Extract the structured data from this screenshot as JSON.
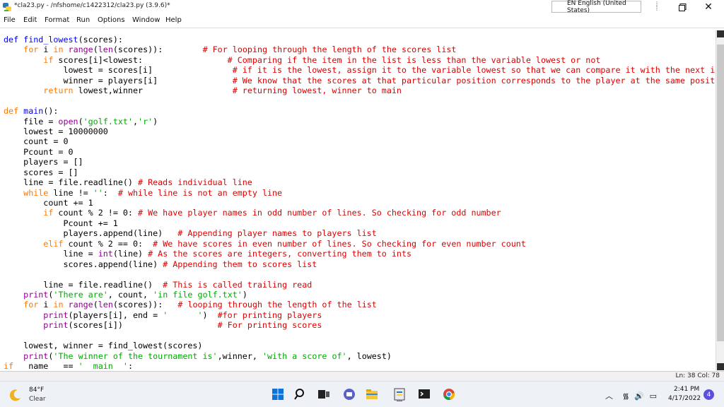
{
  "window": {
    "title": "*cla23.py - /nfshome/c1422312/cla23.py (3.9.6)*",
    "language": "EN English (United States)"
  },
  "menu": {
    "file": "File",
    "edit": "Edit",
    "format": "Format",
    "run": "Run",
    "options": "Options",
    "window": "Window",
    "help": "Help"
  },
  "code_lines": [
    [
      [
        "def",
        "def"
      ],
      [
        "t",
        " "
      ],
      [
        "def",
        "find_lowest"
      ],
      [
        "t",
        "(scores):"
      ]
    ],
    [
      [
        "t",
        "    "
      ],
      [
        "kw",
        "for"
      ],
      [
        "t",
        " i "
      ],
      [
        "kw",
        "in"
      ],
      [
        "t",
        " "
      ],
      [
        "bi",
        "range"
      ],
      [
        "t",
        "("
      ],
      [
        "bi",
        "len"
      ],
      [
        "t",
        "(scores)):        "
      ],
      [
        "cm",
        "# For looping through the length of the scores list"
      ]
    ],
    [
      [
        "t",
        "        "
      ],
      [
        "kw",
        "if"
      ],
      [
        "t",
        " scores[i]<lowest:                 "
      ],
      [
        "cm",
        "# Comparing if the item in the list is less than the variable lowest or not"
      ]
    ],
    [
      [
        "t",
        "            lowest = scores[i]                "
      ],
      [
        "cm",
        "# if it is the lowest, assign it to the variable lowest so that we can compare it with the next iter"
      ]
    ],
    [
      [
        "t",
        "            winner = players[i]               "
      ],
      [
        "cm",
        "# We know that the scores at that particular position corresponds to the player at the same position"
      ]
    ],
    [
      [
        "t",
        "        "
      ],
      [
        "kw",
        "return"
      ],
      [
        "t",
        " lowest,winner                  "
      ],
      [
        "cm",
        "# returning lowest, winner to main"
      ]
    ],
    [
      [
        "t",
        ""
      ]
    ],
    [
      [
        "kw",
        "def"
      ],
      [
        "t",
        " "
      ],
      [
        "def",
        "main"
      ],
      [
        "t",
        "():"
      ]
    ],
    [
      [
        "t",
        "    file = "
      ],
      [
        "bi",
        "open"
      ],
      [
        "t",
        "("
      ],
      [
        "str",
        "'golf.txt'"
      ],
      [
        "t",
        ","
      ],
      [
        "str",
        "'r'"
      ],
      [
        "t",
        ")"
      ]
    ],
    [
      [
        "t",
        "    lowest = 10000000"
      ]
    ],
    [
      [
        "t",
        "    count = 0"
      ]
    ],
    [
      [
        "t",
        "    Pcount = 0"
      ]
    ],
    [
      [
        "t",
        "    players = []"
      ]
    ],
    [
      [
        "t",
        "    scores = []"
      ]
    ],
    [
      [
        "t",
        "    line = file.readline() "
      ],
      [
        "cm",
        "# Reads individual line"
      ]
    ],
    [
      [
        "t",
        "    "
      ],
      [
        "kw",
        "while"
      ],
      [
        "t",
        " line != "
      ],
      [
        "str",
        "''"
      ],
      [
        "t",
        ":  "
      ],
      [
        "cm",
        "# while line is not an empty line"
      ]
    ],
    [
      [
        "t",
        "        count += 1"
      ]
    ],
    [
      [
        "t",
        "        "
      ],
      [
        "kw",
        "if"
      ],
      [
        "t",
        " count % 2 != 0: "
      ],
      [
        "cm",
        "# We have player names in odd number of lines. So checking for odd number"
      ]
    ],
    [
      [
        "t",
        "            Pcount += 1"
      ]
    ],
    [
      [
        "t",
        "            players.append(line)   "
      ],
      [
        "cm",
        "# Appending player names to players list"
      ]
    ],
    [
      [
        "t",
        "        "
      ],
      [
        "kw",
        "elif"
      ],
      [
        "t",
        " count % 2 == 0:  "
      ],
      [
        "cm",
        "# We have scores in even number of lines. So checking for even number count"
      ]
    ],
    [
      [
        "t",
        "            line = "
      ],
      [
        "bi",
        "int"
      ],
      [
        "t",
        "(line) "
      ],
      [
        "cm",
        "# As the scores are integers, converting them to ints"
      ]
    ],
    [
      [
        "t",
        "            scores.append(line) "
      ],
      [
        "cm",
        "# Appending them to scores list"
      ]
    ],
    [
      [
        "t",
        ""
      ]
    ],
    [
      [
        "t",
        "        line = file.readline()  "
      ],
      [
        "cm",
        "# This is called trailing read"
      ]
    ],
    [
      [
        "t",
        "    "
      ],
      [
        "bi",
        "print"
      ],
      [
        "t",
        "("
      ],
      [
        "str",
        "'There are'"
      ],
      [
        "t",
        ", count, "
      ],
      [
        "str",
        "'in file golf.txt'"
      ],
      [
        "t",
        ")"
      ]
    ],
    [
      [
        "t",
        "    "
      ],
      [
        "kw",
        "for"
      ],
      [
        "t",
        " i "
      ],
      [
        "kw",
        "in"
      ],
      [
        "t",
        " "
      ],
      [
        "bi",
        "range"
      ],
      [
        "t",
        "("
      ],
      [
        "bi",
        "len"
      ],
      [
        "t",
        "(scores)):   "
      ],
      [
        "cm",
        "# looping through the length of the list"
      ]
    ],
    [
      [
        "t",
        "        "
      ],
      [
        "bi",
        "print"
      ],
      [
        "t",
        "(players[i], end = "
      ],
      [
        "str",
        "'      '"
      ],
      [
        "t",
        ")  "
      ],
      [
        "cm",
        "#for printing players"
      ]
    ],
    [
      [
        "t",
        "        "
      ],
      [
        "bi",
        "print"
      ],
      [
        "t",
        "(scores[i])                   "
      ],
      [
        "cm",
        "# For printing scores"
      ]
    ],
    [
      [
        "t",
        ""
      ]
    ],
    [
      [
        "t",
        "    lowest, winner = find_lowest(scores)"
      ]
    ],
    [
      [
        "t",
        "    "
      ],
      [
        "bi",
        "print"
      ],
      [
        "t",
        "("
      ],
      [
        "str",
        "'The winner of the tournament is'"
      ],
      [
        "t",
        ",winner, "
      ],
      [
        "str",
        "'with a score of'"
      ],
      [
        "t",
        ", lowest)"
      ]
    ],
    [
      [
        "kw",
        "if"
      ],
      [
        "t",
        " __name__ == "
      ],
      [
        "str",
        "'__main__'"
      ],
      [
        "t",
        ":"
      ]
    ]
  ],
  "status": {
    "position": "Ln: 38  Col: 78"
  },
  "taskbar": {
    "weather_temp": "84°F",
    "weather_desc": "Clear",
    "time": "2:41 PM",
    "date": "4/17/2022",
    "notifications": "4"
  },
  "colors": {
    "keyword": "#ff7700",
    "builtin": "#900090",
    "string": "#00aa00",
    "comment": "#dd0000",
    "definition": "#0000ff"
  }
}
